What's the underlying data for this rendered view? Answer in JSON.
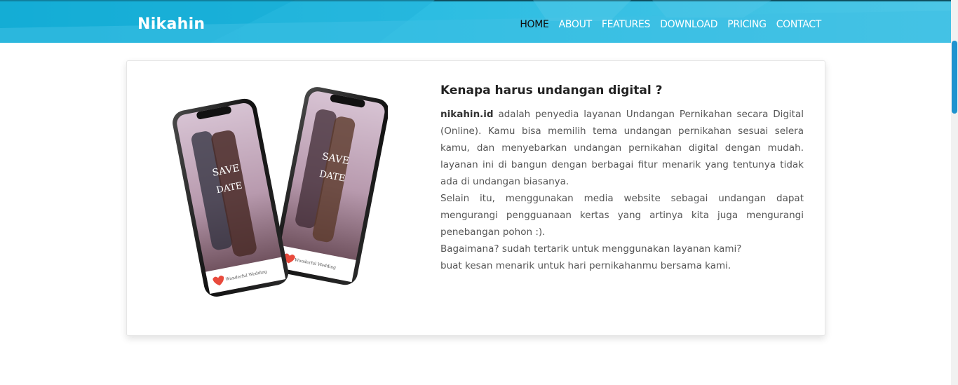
{
  "header": {
    "brand": "Nikahin",
    "nav": [
      {
        "label": "HOME",
        "active": true
      },
      {
        "label": "ABOUT"
      },
      {
        "label": "FEATURES"
      },
      {
        "label": "DOWNLOAD"
      },
      {
        "label": "PRICING"
      },
      {
        "label": "CONTACT"
      }
    ],
    "colors": {
      "primary": "#1fb4da",
      "active_nav": "#111111",
      "scroll_thumb": "#1e93cf"
    }
  },
  "about": {
    "title": "Kenapa harus undangan digital ?",
    "p1_strong": "nikahin.id",
    "p1_rest": " adalah penyedia layanan Undangan Pernikahan secara Digital (Online). Kamu bisa memilih tema undangan pernikahan sesuai selera kamu, dan menyebarkan undangan pernikahan digital dengan mudah. layanan ini di bangun dengan berbagai fitur menarik yang tentunya tidak ada di undangan biasanya.",
    "p2": "Selain itu, menggunakan media website sebagai undangan dapat mengurangi pengguanaan kertas yang artinya kita juga mengurangi penebangan pohon :).",
    "p3": "Bagaimana? sudah tertarik untuk menggunakan layanan kami?",
    "p4": "buat kesan menarik untuk hari pernikahanmu bersama kami.",
    "image": {
      "icon": "phone-mockup-icon",
      "screen_text_1": "SAVE",
      "screen_text_2": "DATE",
      "screen_footer": "Wonderful Wedding"
    }
  }
}
